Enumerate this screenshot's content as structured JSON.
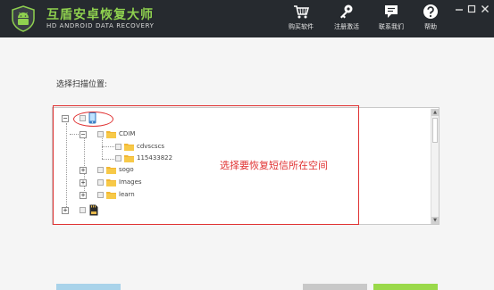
{
  "header": {
    "title": "互盾安卓恢复大师",
    "subtitle": "HD ANDROID DATA RECOVERY",
    "nav": [
      {
        "label": "购买软件",
        "icon": "cart-icon"
      },
      {
        "label": "注册激活",
        "icon": "key-icon"
      },
      {
        "label": "联系我们",
        "icon": "chat-icon"
      },
      {
        "label": "帮助",
        "icon": "help-icon"
      }
    ],
    "window_controls": [
      "minimize-icon",
      "maximize-icon",
      "close-icon"
    ]
  },
  "main": {
    "scan_location_label": "选择扫描位置:",
    "annotation": "选择要恢复短信所在空间",
    "tree": [
      {
        "label": "",
        "icon": "phone-icon",
        "expanded": true
      },
      {
        "label": "CDIM",
        "icon": "folder-icon",
        "expanded": true
      },
      {
        "label": "cdvscscs",
        "icon": "folder-icon"
      },
      {
        "label": "115433822",
        "icon": "folder-icon"
      },
      {
        "label": "sogo",
        "icon": "folder-icon",
        "expanded": false
      },
      {
        "label": "Images",
        "icon": "folder-icon",
        "expanded": false
      },
      {
        "label": "learn",
        "icon": "folder-icon",
        "expanded": false
      },
      {
        "label": "",
        "icon": "sd-card-icon",
        "expanded": false
      }
    ],
    "expand_symbol": "+",
    "collapse_symbol": "−"
  },
  "colors": {
    "header_bg": "#262a2f",
    "title_green": "#8fd14f",
    "highlight_red": "#e03232",
    "folder_yellow": "#f2b632",
    "button_blue": "#a9d3ea",
    "button_gray": "#c8c8c8",
    "button_green": "#9ad94a"
  }
}
